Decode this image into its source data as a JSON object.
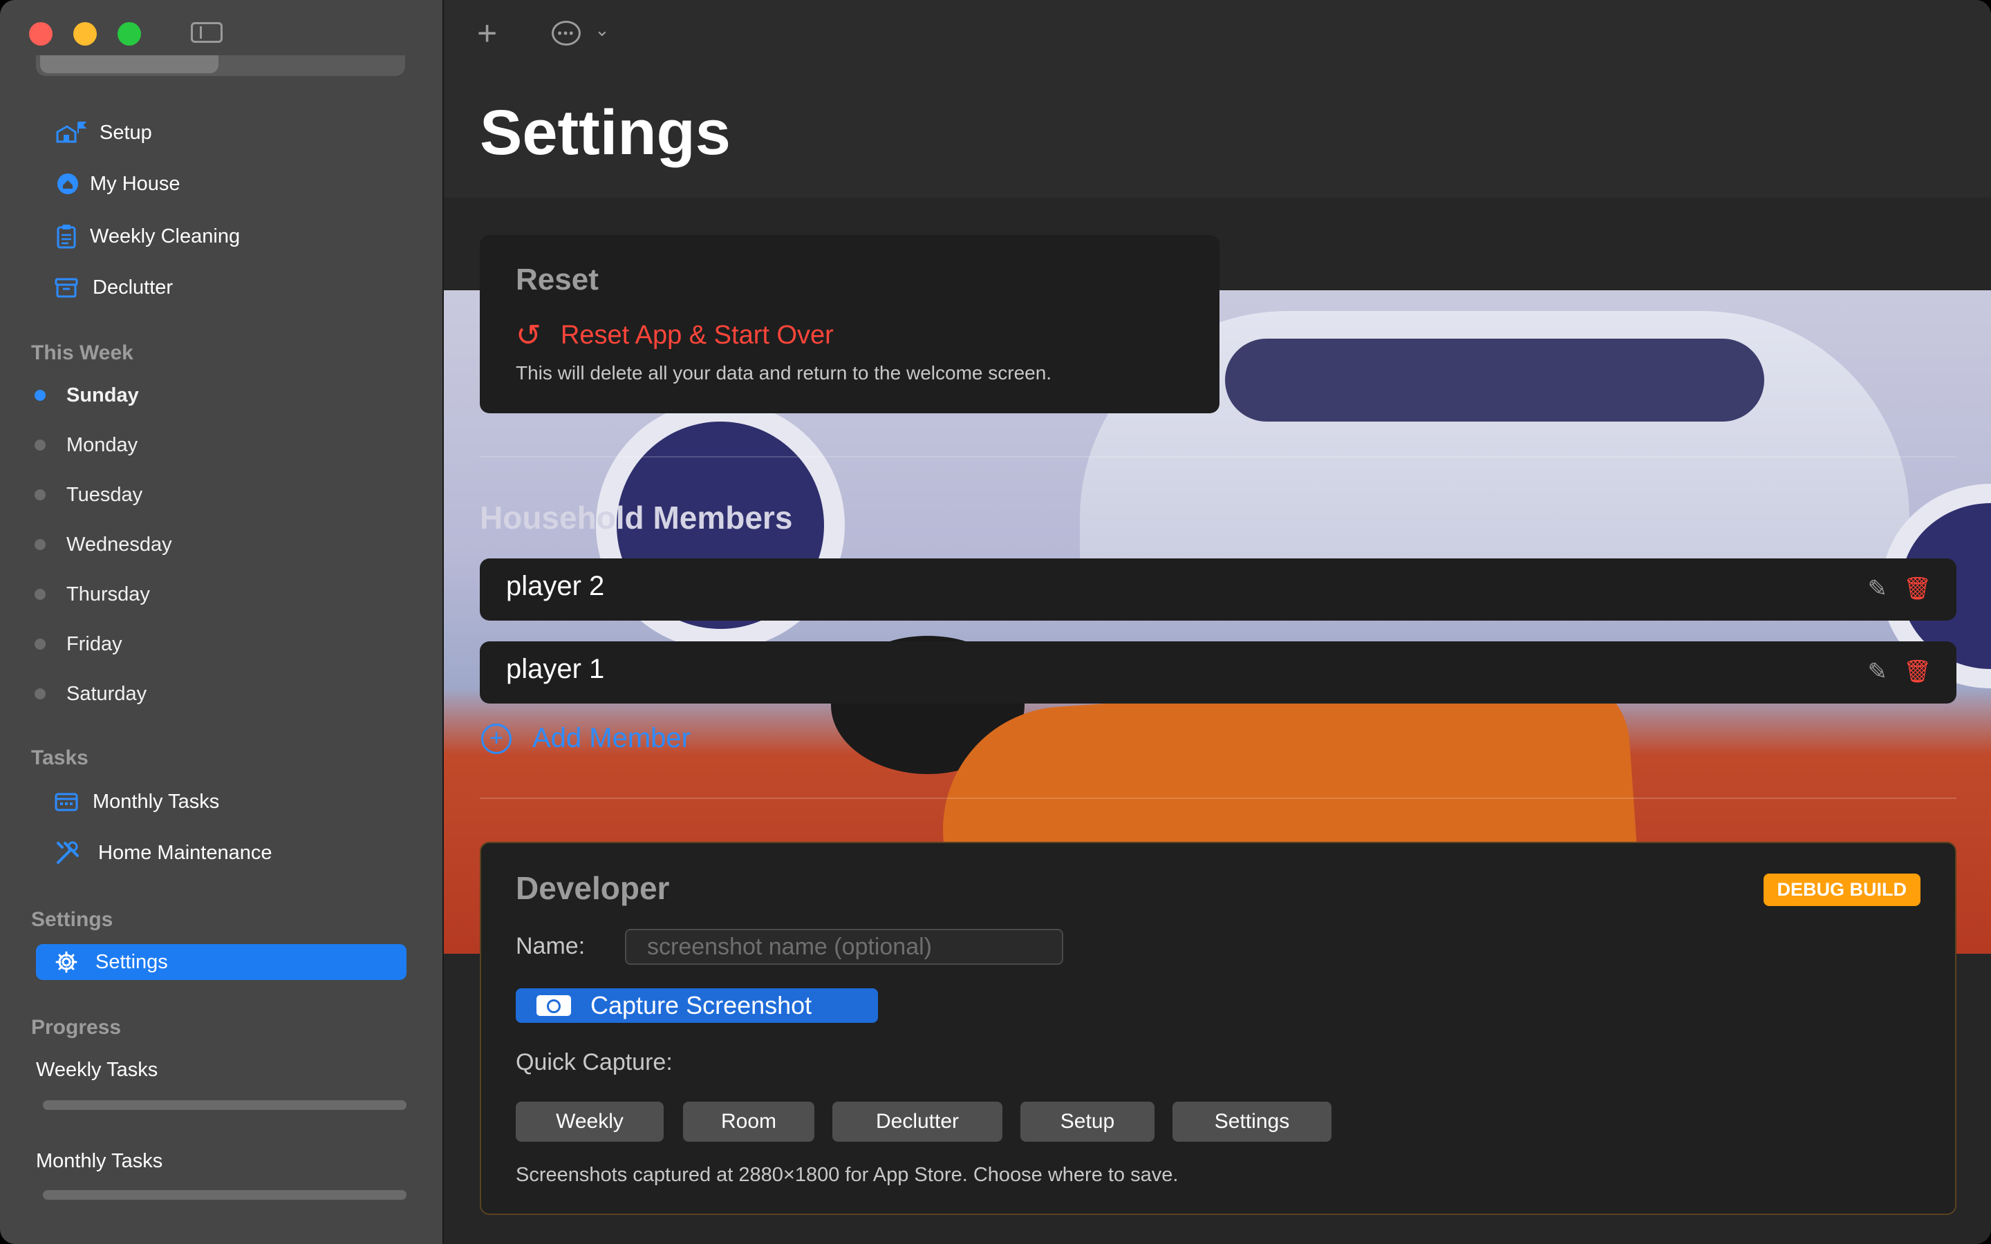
{
  "sidebar": {
    "nav_items": [
      {
        "label": "Setup",
        "icon": "house-flag-icon"
      },
      {
        "label": "My House",
        "icon": "house-circle-icon"
      },
      {
        "label": "Weekly Cleaning",
        "icon": "clipboard-icon"
      },
      {
        "label": "Declutter",
        "icon": "archive-box-icon"
      }
    ],
    "this_week_heading": "This Week",
    "days": [
      "Sunday",
      "Monday",
      "Tuesday",
      "Wednesday",
      "Thursday",
      "Friday",
      "Saturday"
    ],
    "active_day": "Sunday",
    "tasks_heading": "Tasks",
    "task_items": [
      {
        "label": "Monthly Tasks",
        "icon": "calendar-icon"
      },
      {
        "label": "Home Maintenance",
        "icon": "wrench-screwdriver-icon"
      }
    ],
    "settings_heading": "Settings",
    "settings_item": "Settings",
    "progress_heading": "Progress",
    "progress": [
      {
        "label": "Weekly Tasks",
        "value": 0.0
      },
      {
        "label": "Monthly Tasks",
        "value": 0.0
      }
    ]
  },
  "main": {
    "title": "Settings",
    "reset": {
      "heading": "Reset",
      "button_label": "Reset App & Start Over",
      "description": "This will delete all your data and return to the welcome screen."
    },
    "household": {
      "heading": "Household Members",
      "members": [
        "player 2",
        "player 1"
      ],
      "add_label": "Add Member"
    },
    "developer": {
      "heading": "Developer",
      "badge": "DEBUG BUILD",
      "name_label": "Name:",
      "name_placeholder": "screenshot name (optional)",
      "name_value": "",
      "capture_label": "Capture Screenshot",
      "quick_capture_label": "Quick Capture:",
      "quick_capture_buttons": [
        "Weekly",
        "Room",
        "Declutter",
        "Setup",
        "Settings"
      ],
      "footer": "Screenshots captured at 2880×1800 for App Store. Choose where to save."
    }
  },
  "colors": {
    "accent": "#2d8cff",
    "destructive": "#ff453a",
    "badge": "#ff9f0a",
    "sidebar_bg": "#464646",
    "main_bg": "#262626"
  }
}
